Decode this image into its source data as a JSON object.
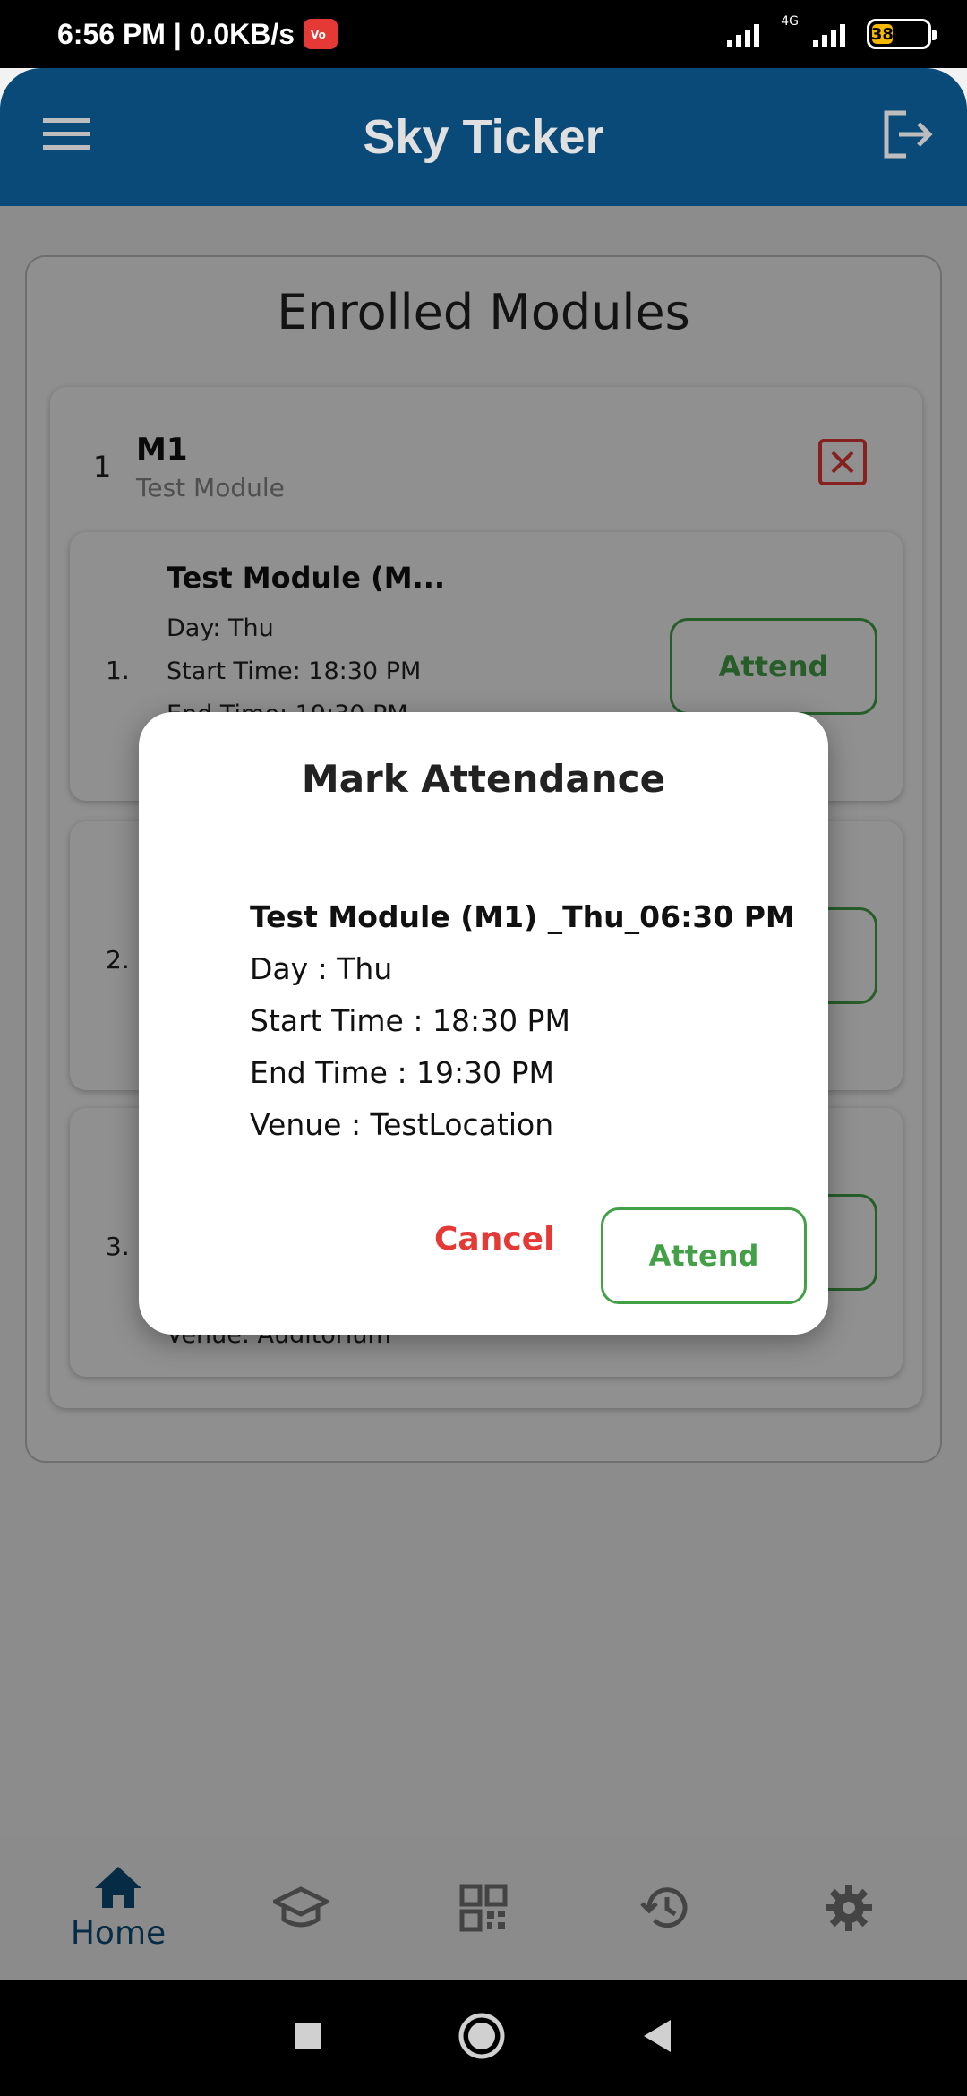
{
  "status_bar": {
    "time": "6:56 PM | 0.0KB/s",
    "volte": "VoLTE",
    "network": "4G",
    "battery": "38"
  },
  "app_bar": {
    "title": "Sky Ticker",
    "menu_icon": "hamburger-menu-icon",
    "logout_icon": "logout-icon"
  },
  "page": {
    "title": "Enrolled Modules"
  },
  "module": {
    "index": "1",
    "code": "M1",
    "name": "Test Module",
    "remove_icon": "close-box-icon"
  },
  "sessions": [
    {
      "number": "1.",
      "title": "Test Module (M...",
      "day": "Day: Thu",
      "start": "Start Time: 18:30 PM",
      "end": "End Time: 19:30 PM",
      "attend_label": "Attend"
    },
    {
      "number": "2.",
      "attend_label": "Attend"
    },
    {
      "number": "3.",
      "venue": "Venue: Auditorium",
      "attend_label": "Attend"
    }
  ],
  "dialog": {
    "title": "Mark Attendance",
    "session_title": "Test Module (M1) _Thu_06:30 PM",
    "day": "Day : Thu",
    "start": "Start Time : 18:30 PM",
    "end": "End Time : 19:30 PM",
    "venue": "Venue : TestLocation",
    "cancel_label": "Cancel",
    "attend_label": "Attend"
  },
  "bottom_nav": {
    "items": [
      {
        "label": "Home",
        "icon": "home-icon",
        "active": true
      },
      {
        "label": "",
        "icon": "graduation-cap-icon",
        "active": false
      },
      {
        "label": "",
        "icon": "qr-code-icon",
        "active": false
      },
      {
        "label": "",
        "icon": "history-icon",
        "active": false
      },
      {
        "label": "",
        "icon": "settings-gear-icon",
        "active": false
      }
    ]
  },
  "colors": {
    "app_bar": "#0a4a78",
    "accent_green": "#43a047",
    "danger_red": "#e53935"
  }
}
